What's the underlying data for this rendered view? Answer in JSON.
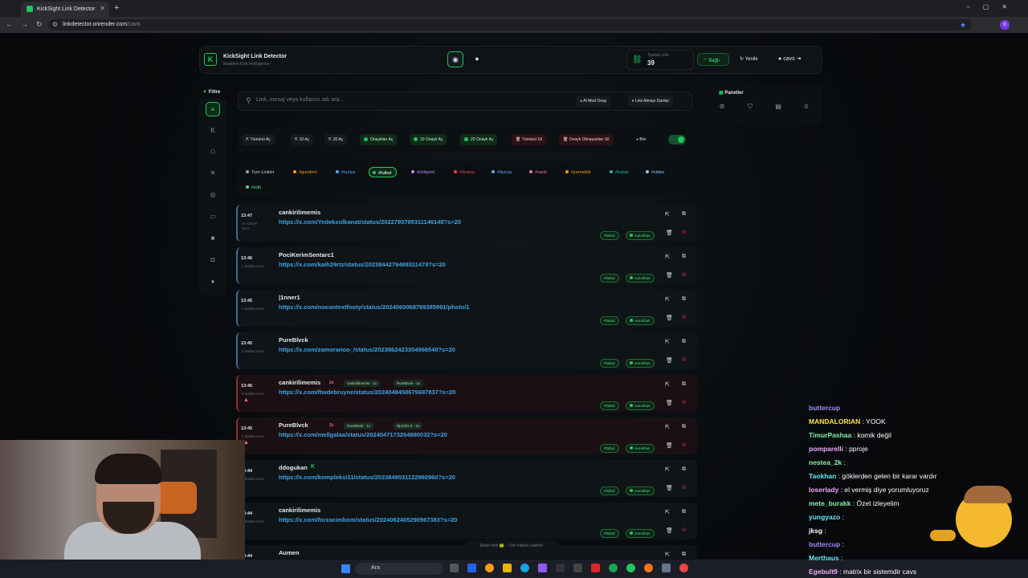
{
  "browser": {
    "tab_title": "KickSight Link Detector",
    "url_host": "linkdetector.onrender.com",
    "url_path": "/cavs"
  },
  "header": {
    "brand": "KickSight Link Detector",
    "subtitle": "Realtime Kick Intelligence",
    "stat_label": "Toplam Link",
    "stat_value": "39",
    "connected": "Bağlı",
    "refresh": "Yenile",
    "user": "cavs"
  },
  "sidebar": {
    "filter_label": "Filtre"
  },
  "search": {
    "placeholder": "Link, mesaj veya kullanıcı adı ara...",
    "ai_mod": "AI Mod Onay",
    "stop": "Link Almayı Durdur"
  },
  "actions": [
    "Tümünü Aç",
    "10 Aç",
    "20 Aç",
    "Onaylıları Aç",
    "10 Onaylı Aç",
    "20 Onaylı Aç",
    "Tümünü Sil",
    "Onaylı Olmayanları Sil",
    "Bot"
  ],
  "tags": [
    "Tum Linkler",
    "#gundem",
    "#suriye",
    "#futbol",
    "#shitpost",
    "#drama",
    "#dunya",
    "#sarki",
    "#yemeklik",
    "#haber",
    "#video",
    "#edit"
  ],
  "panels": {
    "label": "Paneller"
  },
  "rows": [
    {
      "time": "13:47",
      "ago": "47 saniye önce",
      "user": "cankirilimemis",
      "url": "https://x.com/Yedeksolkanat/status/2022793785311146148?s=20",
      "tag": "#futbol",
      "mod": "nusokhan"
    },
    {
      "time": "13:46",
      "ago": "1 dakika önce",
      "user": "PociKerimSentarc1",
      "url": "https://x.com/kaih29rtz/status/2023844279488311478?s=20",
      "tag": "#futbol",
      "mod": "nusokhan"
    },
    {
      "time": "13:45",
      "ago": "2 dakika önce",
      "user": "|1nner1",
      "url": "https://x.com/nocontextfooty/status/2024060068799385991/photo/1",
      "tag": "#futbol",
      "mod": "nusokhan"
    },
    {
      "time": "13:45",
      "ago": "2 dakika önce",
      "user": "PureBlvck",
      "url": "https://x.com/zamoranoo_/status/2023862423304966540?s=20",
      "tag": "#futbol",
      "mod": "nusokhan"
    },
    {
      "time": "13:45",
      "ago": "2 dakika önce",
      "user": "cankirilimemis",
      "dup": "2x",
      "chips": [
        "cankirilimemis - 1x",
        "PureBlvck - 1x"
      ],
      "url": "https://x.com/ftwdebruyne/status/2024049450679697837?s=20",
      "tag": "#futbol",
      "mod": "nusokhan"
    },
    {
      "time": "13:45",
      "ago": "2 dakika önce",
      "user": "PureBlvck",
      "dup": "2x",
      "chips": [
        "PureBlvck - 1x",
        "Njord11 K - 1x"
      ],
      "url": "https://x.com/mellgalaa/status/2024047173264880032?s=20",
      "tag": "#futbol",
      "mod": "nusokhan"
    },
    {
      "time": "13:44",
      "ago": "3 dakika önce",
      "user": "ddogukan",
      "url": "https://x.com/kompleksi11/status/2023849031122980960?s=20",
      "tag": "#futbol",
      "mod": "nusokhan"
    },
    {
      "time": "13:44",
      "ago": "3 dakika önce",
      "user": "cankirilimemis",
      "url": "https://x.com/forzacimbom/status/2024062405290967383?s=20",
      "tag": "#futbol",
      "mod": "nusokhan"
    },
    {
      "time": "13:44",
      "ago": "",
      "user": "Aumen",
      "url": "",
      "tag": "",
      "mod": ""
    }
  ],
  "footer": "Made with 🐸 - Tüm hakları saklıdır",
  "taskbar": {
    "search": "Ara"
  },
  "chat": [
    {
      "n": "buttercup",
      "t": ""
    },
    {
      "n": "MANDALORIAN",
      "t": " : YOOK"
    },
    {
      "n": "TimurPashaa",
      "t": " : komik değil"
    },
    {
      "n": "pomparelli",
      "t": " : pproje"
    },
    {
      "n": "nestea_2k",
      "t": " : "
    },
    {
      "n": "Taokhan",
      "t": " : göklerden gelen bir karar vardır"
    },
    {
      "n": "loserlady",
      "t": " : el vermiş diye yorumluyoruz"
    },
    {
      "n": "mete_burakk",
      "t": " : Özet izleyelim"
    },
    {
      "n": "yungyazo",
      "t": " : "
    },
    {
      "n": "jksg",
      "t": " : "
    },
    {
      "n": "buttercup",
      "t": " : "
    },
    {
      "n": "Merthaus",
      "t": " : "
    },
    {
      "n": "Egebult9",
      "t": " : matrix bir sistemdir cavs"
    }
  ]
}
